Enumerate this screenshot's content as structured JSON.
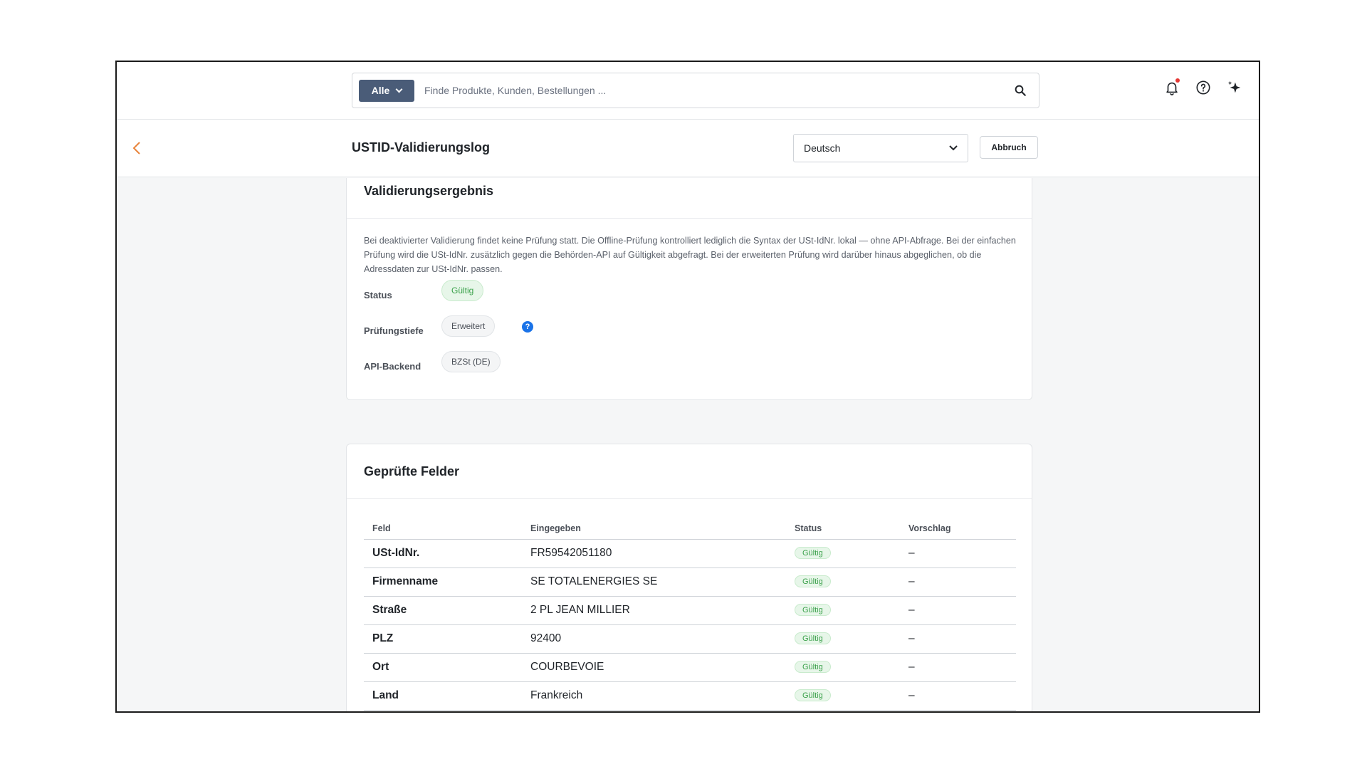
{
  "search": {
    "scope_label": "Alle",
    "placeholder": "Finde Produkte, Kunden, Bestellungen ..."
  },
  "header": {
    "title": "USTID-Validierungslog",
    "language": "Deutsch",
    "cancel_label": "Abbruch"
  },
  "result_card": {
    "title": "Validierungsergebnis",
    "description": "Bei deaktivierter Validierung findet keine Prüfung statt. Die Offline-Prüfung kontrolliert lediglich die Syntax der USt-IdNr. lokal — ohne API-Abfrage. Bei der einfachen Prüfung wird die USt-IdNr. zusätzlich gegen die Behörden-API auf Gültigkeit abgefragt. Bei der erweiterten Prüfung wird darüber hinaus abgeglichen, ob die Adressdaten zur USt-IdNr. passen.",
    "status_label": "Status",
    "status_value": "Gültig",
    "depth_label": "Prüfungstiefe",
    "depth_value": "Erweitert",
    "info_glyph": "?",
    "backend_label": "API-Backend",
    "backend_value": "BZSt (DE)"
  },
  "fields_card": {
    "title": "Geprüfte Felder",
    "columns": [
      "Feld",
      "Eingegeben",
      "Status",
      "Vorschlag"
    ],
    "rows": [
      {
        "field": "USt-IdNr.",
        "entered": "FR59542051180",
        "status": "Gültig",
        "suggestion": "–"
      },
      {
        "field": "Firmenname",
        "entered": "SE TOTALENERGIES SE",
        "status": "Gültig",
        "suggestion": "–"
      },
      {
        "field": "Straße",
        "entered": "2 PL JEAN MILLIER",
        "status": "Gültig",
        "suggestion": "–"
      },
      {
        "field": "PLZ",
        "entered": "92400",
        "status": "Gültig",
        "suggestion": "–"
      },
      {
        "field": "Ort",
        "entered": "COURBEVOIE",
        "status": "Gültig",
        "suggestion": "–"
      },
      {
        "field": "Land",
        "entered": "Frankreich",
        "status": "Gültig",
        "suggestion": "–"
      }
    ]
  },
  "icons": [
    "chevron-down-icon",
    "search-icon",
    "bell-icon",
    "help-icon",
    "sparkle-icon",
    "back-chevron-icon",
    "info-icon"
  ],
  "colors": {
    "accent_button": "#4a5c78",
    "back_arrow": "#e8833a",
    "valid_green": "#3aa14a",
    "info_blue": "#1a73e8",
    "notification_dot": "#e53935"
  }
}
